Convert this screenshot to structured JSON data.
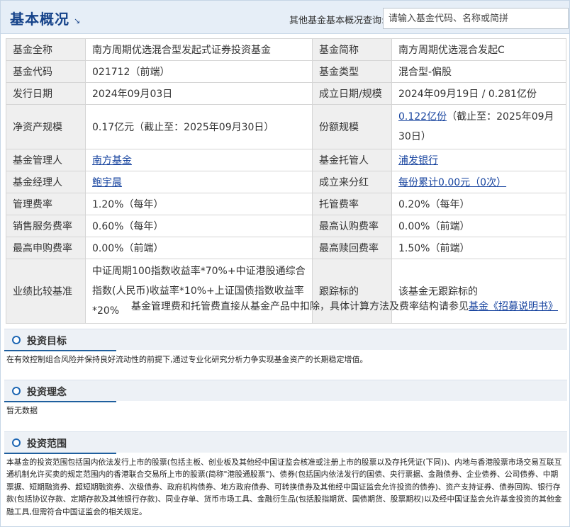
{
  "header": {
    "title": "基本概况",
    "arrow": "↘",
    "search_label": "其他基金基本概况查询:",
    "search_placeholder": "请输入基金代码、名称或简拼"
  },
  "info": {
    "full_name_label": "基金全称",
    "full_name": "南方周期优选混合型发起式证券投资基金",
    "short_name_label": "基金简称",
    "short_name": "南方周期优选混合发起C",
    "code_label": "基金代码",
    "code": "021712（前端）",
    "type_label": "基金类型",
    "type": "混合型-偏股",
    "issue_date_label": "发行日期",
    "issue_date": "2024年09月03日",
    "established_label": "成立日期/规模",
    "established": "2024年09月19日 / 0.281亿份",
    "net_assets_label": "净资产规模",
    "net_assets": "0.17亿元（截止至：2025年09月30日）",
    "shares_label": "份额规模",
    "shares_link": "0.122亿份",
    "shares_suffix": "（截止至：2025年09月30日）",
    "manager_label": "基金管理人",
    "manager": "南方基金",
    "custodian_label": "基金托管人",
    "custodian": "浦发银行",
    "fund_manager_label": "基金经理人",
    "fund_manager": "鲍宇晨",
    "dividend_label": "成立来分红",
    "dividend": "每份累计0.00元（0次）",
    "mgmt_fee_label": "管理费率",
    "mgmt_fee": "1.20%（每年）",
    "custody_fee_label": "托管费率",
    "custody_fee": "0.20%（每年）",
    "sales_fee_label": "销售服务费率",
    "sales_fee": "0.60%（每年）",
    "max_subscribe_label": "最高认购费率",
    "max_subscribe": "0.00%（前端）",
    "max_purchase_label": "最高申购费率",
    "max_purchase": "0.00%（前端）",
    "max_redeem_label": "最高赎回费率",
    "max_redeem": "1.50%（前端）",
    "benchmark_label": "业绩比较基准",
    "benchmark": "中证周期100指数收益率*70%+中证港股通综合指数(人民币)收益率*10%+上证国债指数收益率*20%",
    "tracking_label": "跟踪标的",
    "tracking": "该基金无跟踪标的"
  },
  "note": {
    "text": "基金管理费和托管费直接从基金产品中扣除，具体计算方法及费率结构请参见",
    "link": "基金《招募说明书》"
  },
  "sections": {
    "goal_title": "投资目标",
    "goal_text": "在有效控制组合风险并保持良好流动性的前提下,通过专业化研究分析力争实现基金资产的长期稳定增值。",
    "idea_title": "投资理念",
    "idea_text": "暂无数据",
    "scope_title": "投资范围",
    "scope_text": "本基金的投资范围包括国内依法发行上市的股票(包括主板、创业板及其他经中国证监会核准或注册上市的股票以及存托凭证(下同))、内地与香港股票市场交易互联互通机制允许买卖的规定范围内的香港联合交易所上市的股票(简称\"港股通股票\")、债券(包括国内依法发行的国债、央行票据、金融债券、企业债券、公司债券、中期票据、短期融资券、超短期融资券、次级债券、政府机构债券、地方政府债券、可转换债券及其他经中国证监会允许投资的债券)、资产支持证券、债券回购、银行存款(包括协议存款、定期存款及其他银行存款)、同业存单、货币市场工具、金融衍生品(包括股指期货、国债期货、股票期权)以及经中国证监会允许基金投资的其他金融工具,但需符合中国证监会的相关规定。"
  }
}
